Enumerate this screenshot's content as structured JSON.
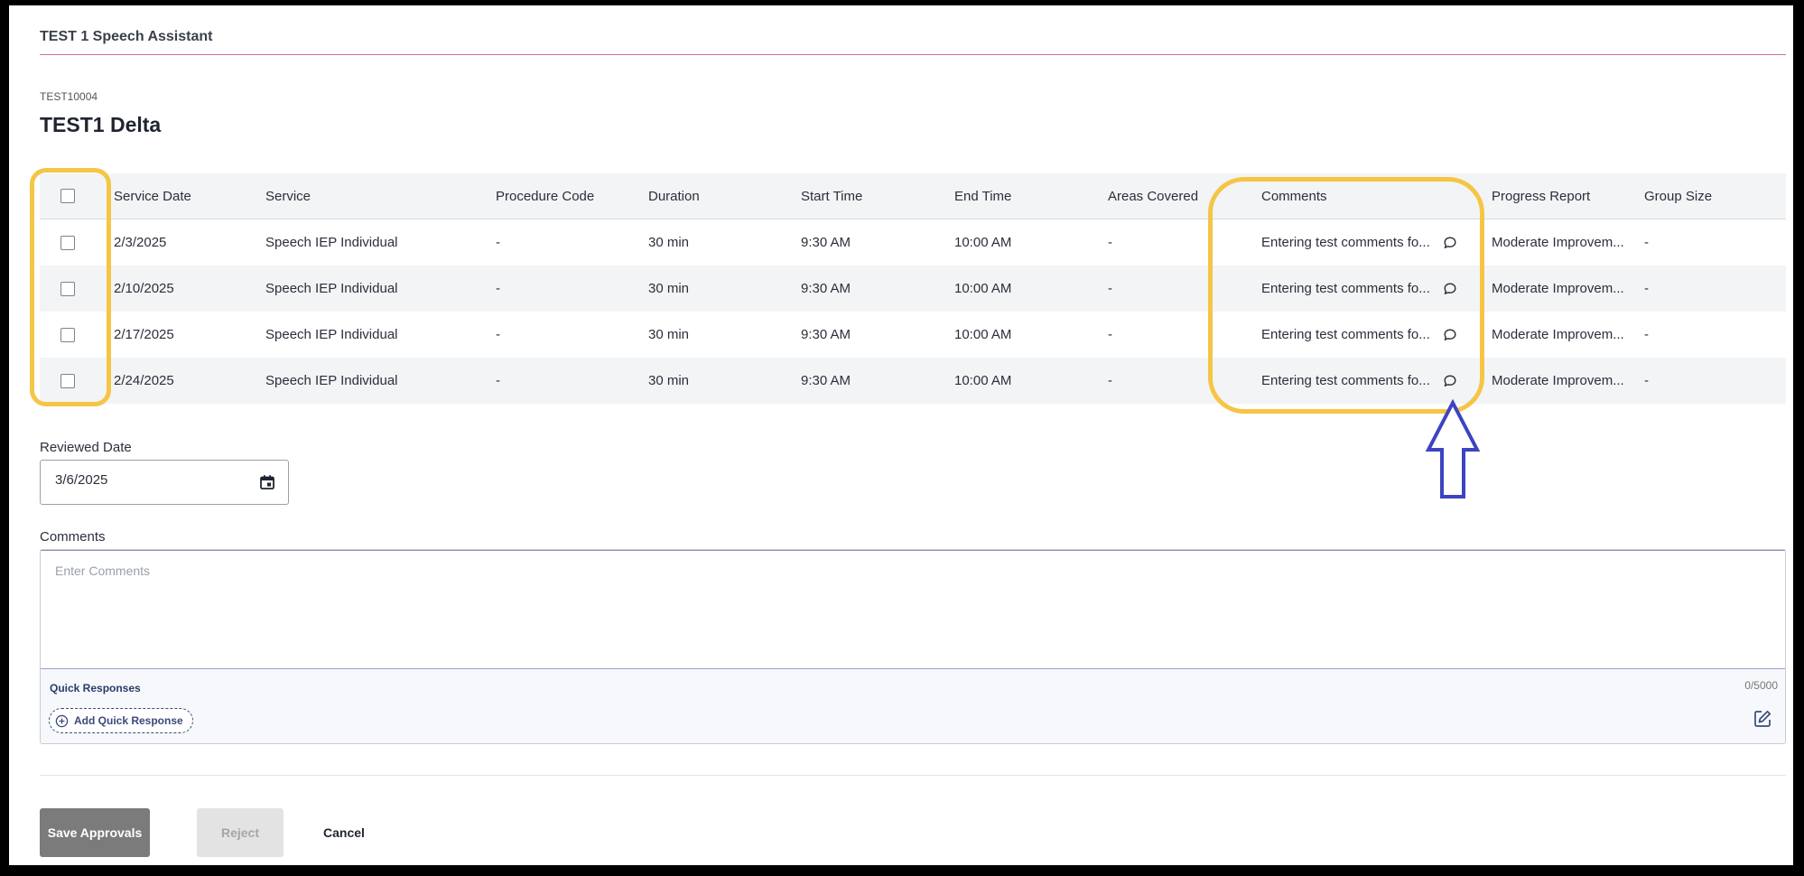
{
  "header": {
    "title": "TEST 1 Speech Assistant"
  },
  "student": {
    "id": "TEST10004",
    "name": "TEST1 Delta"
  },
  "table": {
    "columns": {
      "service_date": "Service Date",
      "service": "Service",
      "procedure_code": "Procedure Code",
      "duration": "Duration",
      "start_time": "Start Time",
      "end_time": "End Time",
      "areas_covered": "Areas Covered",
      "comments": "Comments",
      "progress_report": "Progress Report",
      "group_size": "Group Size"
    },
    "rows": [
      {
        "service_date": "2/3/2025",
        "service": "Speech IEP Individual",
        "procedure_code": "-",
        "duration": "30 min",
        "start_time": "9:30 AM",
        "end_time": "10:00 AM",
        "areas_covered": "-",
        "comments": "Entering test comments fo...",
        "progress_report": "Moderate Improvem...",
        "group_size": "-"
      },
      {
        "service_date": "2/10/2025",
        "service": "Speech IEP Individual",
        "procedure_code": "-",
        "duration": "30 min",
        "start_time": "9:30 AM",
        "end_time": "10:00 AM",
        "areas_covered": "-",
        "comments": "Entering test comments fo...",
        "progress_report": "Moderate Improvem...",
        "group_size": "-"
      },
      {
        "service_date": "2/17/2025",
        "service": "Speech IEP Individual",
        "procedure_code": "-",
        "duration": "30 min",
        "start_time": "9:30 AM",
        "end_time": "10:00 AM",
        "areas_covered": "-",
        "comments": "Entering test comments fo...",
        "progress_report": "Moderate Improvem...",
        "group_size": "-"
      },
      {
        "service_date": "2/24/2025",
        "service": "Speech IEP Individual",
        "procedure_code": "-",
        "duration": "30 min",
        "start_time": "9:30 AM",
        "end_time": "10:00 AM",
        "areas_covered": "-",
        "comments": "Entering test comments fo...",
        "progress_report": "Moderate Improvem...",
        "group_size": "-"
      }
    ]
  },
  "reviewed_date": {
    "label": "Reviewed Date",
    "value": "3/6/2025"
  },
  "comments_section": {
    "label": "Comments",
    "placeholder": "Enter Comments",
    "quick_responses_label": "Quick Responses",
    "counter": "0/5000",
    "add_quick_response": "Add Quick Response"
  },
  "actions": {
    "save": "Save Approvals",
    "reject": "Reject",
    "cancel": "Cancel"
  },
  "colors": {
    "highlight": "#f5c545",
    "arrow": "#3c44c0",
    "header_rule": "#d46aa4",
    "save_button": "#7b7b7b"
  },
  "icons": {
    "comment": "chat-bubble-icon",
    "calendar": "calendar-icon",
    "add": "plus-circle-icon",
    "edit": "edit-icon",
    "annotation": "up-arrow-icon"
  }
}
